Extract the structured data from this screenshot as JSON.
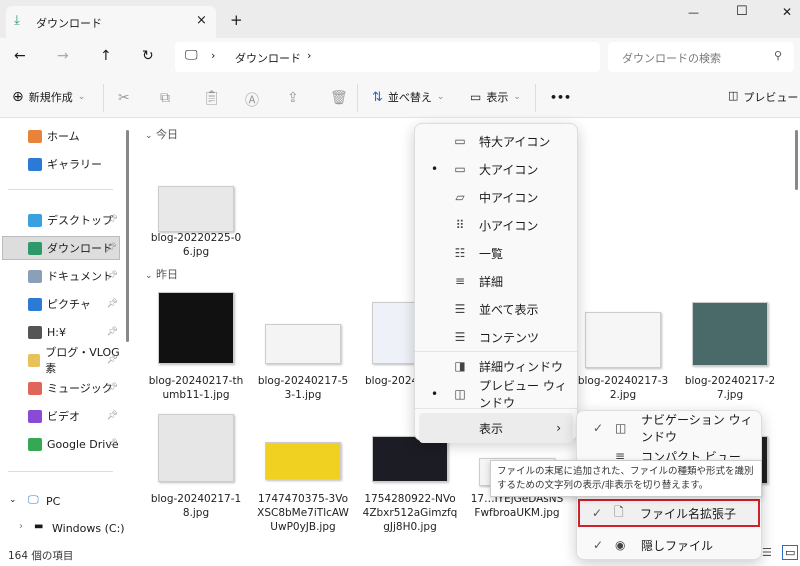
{
  "window": {
    "tab_title": "ダウンロード",
    "new_tab": "+",
    "close_tab": "×",
    "minimize": "—",
    "maximize": "☐",
    "close": "✕"
  },
  "address": {
    "back": "←",
    "forward": "→",
    "up": "↑",
    "refresh": "↻",
    "sep": "›",
    "crumb": "ダウンロード",
    "search_placeholder": "ダウンロードの検索"
  },
  "toolbar": {
    "new": "新規作成",
    "sort": "並べ替え",
    "view": "表示",
    "more": "•••",
    "preview": "プレビュー"
  },
  "sidebar": {
    "items": [
      {
        "label": "ホーム",
        "color": "#e8833a",
        "pinned": false
      },
      {
        "label": "ギャラリー",
        "color": "#2b7bd6",
        "pinned": false
      },
      {
        "label": "デスクトップ",
        "color": "#3aa0e0",
        "pinned": true
      },
      {
        "label": "ダウンロード",
        "color": "#2e9a6b",
        "pinned": true,
        "selected": true
      },
      {
        "label": "ドキュメント",
        "color": "#8aa0b8",
        "pinned": true
      },
      {
        "label": "ピクチャ",
        "color": "#2b7bd6",
        "pinned": true
      },
      {
        "label": "H:¥",
        "color": "#555555",
        "pinned": true
      },
      {
        "label": "ブログ・VLOG素",
        "color": "#e8c15a",
        "pinned": true
      },
      {
        "label": "ミュージック",
        "color": "#e0665a",
        "pinned": true
      },
      {
        "label": "ビデオ",
        "color": "#8a4ad6",
        "pinned": true
      },
      {
        "label": "Google Drive",
        "color": "#34a853",
        "pinned": true
      }
    ],
    "pc": "PC",
    "drive": "Windows (C:)"
  },
  "groups": {
    "today": "今日",
    "yesterday": "昨日"
  },
  "files": {
    "today": [
      {
        "name": "blog-20220225-06.jpg",
        "thumb": "#e8e8e8"
      }
    ],
    "yesterday": [
      {
        "name": "blog-20240217-thumb11-1.jpg",
        "thumb": "#111111"
      },
      {
        "name": "blog-20240217-53-1.jpg",
        "thumb": "#f4f4f4"
      },
      {
        "name": "blog-2024…0.jpg",
        "thumb": "#eef2f8"
      },
      {
        "name": "blog-20240217-32.jpg",
        "thumb": "#f6f6f6"
      },
      {
        "name": "blog-20240217-27.jpg",
        "thumb": "#4a6a6a"
      },
      {
        "name": "blog-20240217-18.jpg",
        "thumb": "#e6e6e6"
      },
      {
        "name": "1747470375-3VoXSC8bMe7iTlcAWUwP0yJB.jpg",
        "thumb": "#f0d020"
      },
      {
        "name": "1754280922-NVo4Zbxr512aGimzfqgJj8H0.jpg",
        "thumb": "#1c1c24"
      },
      {
        "name": "17…IYEjGeDAsNSFwfbroaUKM.jpg",
        "thumb": "#f4f4f4"
      },
      {
        "name": "…jp",
        "thumb": "#222222"
      }
    ]
  },
  "status": {
    "count": "164 個の項目"
  },
  "view_menu": {
    "items": [
      {
        "label": "特大アイコン",
        "icon": "monitor-icon",
        "glyph": "▭"
      },
      {
        "label": "大アイコン",
        "icon": "monitor-icon",
        "glyph": "▭",
        "selected": true
      },
      {
        "label": "中アイコン",
        "icon": "monitor-icon",
        "glyph": "▱"
      },
      {
        "label": "小アイコン",
        "icon": "grid-icon",
        "glyph": "⠿"
      },
      {
        "label": "一覧",
        "icon": "list-icon",
        "glyph": "☷"
      },
      {
        "label": "詳細",
        "icon": "details-icon",
        "glyph": "≡"
      },
      {
        "label": "並べて表示",
        "icon": "tiles-icon",
        "glyph": "☰"
      },
      {
        "label": "コンテンツ",
        "icon": "content-icon",
        "glyph": "☰"
      },
      {
        "label": "詳細ウィンドウ",
        "icon": "details-pane-icon",
        "glyph": "◨"
      },
      {
        "label": "プレビュー ウィンドウ",
        "icon": "preview-pane-icon",
        "glyph": "◫",
        "selected": true
      },
      {
        "label": "表示",
        "icon": "",
        "glyph": "",
        "submenu": true
      }
    ],
    "dot": "•",
    "arrow": "›"
  },
  "show_submenu": {
    "items": [
      {
        "label": "ナビゲーション ウィンドウ",
        "glyph": "◫",
        "checked": true
      },
      {
        "label": "コンパクト ビュー",
        "glyph": "≡",
        "checked": false
      },
      {
        "label": "ファイル名拡張子",
        "glyph": "🗋",
        "checked": true,
        "highlighted": true
      },
      {
        "label": "隠しファイル",
        "glyph": "◉",
        "checked": true
      }
    ],
    "check": "✓"
  },
  "tooltip": {
    "text": "ファイルの末尾に追加された、ファイルの種類や形式を識別するための文字列の表示/非表示を切り替えます。"
  },
  "colors": {
    "accent": "#2e9a6b",
    "highlight_border": "#d0202a"
  }
}
